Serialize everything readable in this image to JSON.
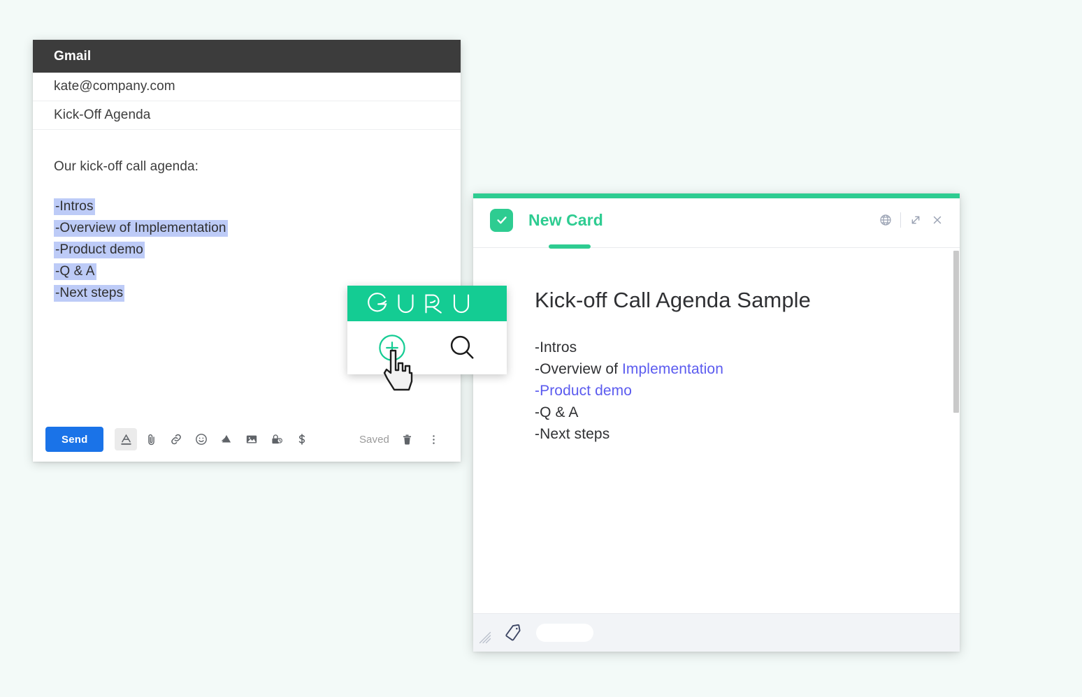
{
  "background_color": "#f3faf8",
  "gmail": {
    "title": "Gmail",
    "recipient": "kate@company.com",
    "subject": "Kick-Off Agenda",
    "body_intro": "Our kick-off call agenda:",
    "agenda_items": [
      "-Intros",
      "-Overview of Implementation",
      "-Product demo",
      "-Q & A",
      "-Next steps"
    ],
    "selection_highlight_color": "#bdcbf7",
    "toolbar": {
      "send_label": "Send",
      "send_color": "#1a73e8",
      "saved_label": "Saved",
      "icons": [
        "format-text-icon",
        "attach-file-icon",
        "insert-link-icon",
        "insert-emoji-icon",
        "google-drive-icon",
        "insert-photo-icon",
        "confidential-mode-icon",
        "insert-money-icon"
      ],
      "right_icons": [
        "trash-icon",
        "more-options-icon"
      ]
    }
  },
  "guru_widget": {
    "logo_text": "GURU",
    "brand_color": "#14cc93",
    "actions": [
      "add-card-icon",
      "search-icon"
    ],
    "cursor": "hand-pointer-cursor"
  },
  "card_panel": {
    "title": "New Card",
    "brand_color": "#2ecc91",
    "checkbox_icon": "checkbox-checked-icon",
    "header_icons": [
      "globe-icon",
      "expand-icon",
      "close-icon"
    ],
    "content": {
      "heading": "Kick-off Call Agenda Sample",
      "lines": [
        {
          "parts": [
            {
              "text": "-Intros",
              "link": false
            }
          ]
        },
        {
          "parts": [
            {
              "text": "-Overview of ",
              "link": false
            },
            {
              "text": "Implementation",
              "link": true
            }
          ]
        },
        {
          "parts": [
            {
              "text": "-Product demo",
              "link": true
            }
          ]
        },
        {
          "parts": [
            {
              "text": "-Q & A",
              "link": false
            }
          ]
        },
        {
          "parts": [
            {
              "text": "-Next steps",
              "link": false
            }
          ]
        }
      ],
      "link_color": "#5b5bef"
    },
    "footer": {
      "icons": [
        "resize-grip-icon",
        "tag-icon"
      ],
      "tag_chip_label": ""
    }
  }
}
